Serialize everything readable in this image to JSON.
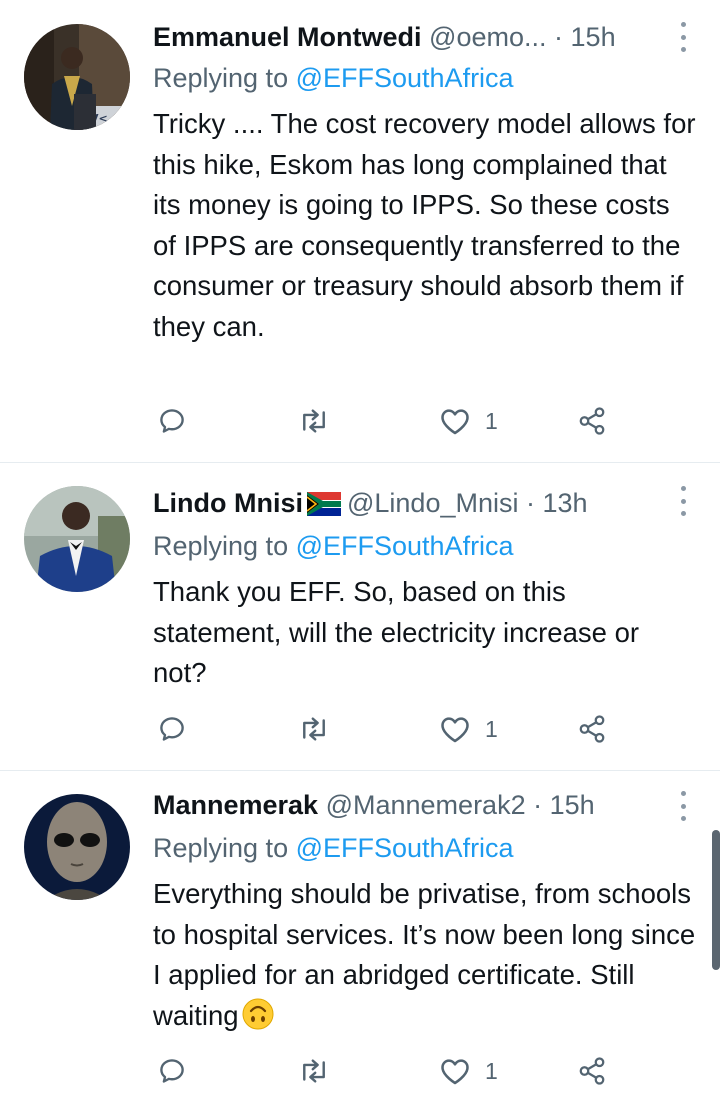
{
  "tweets": [
    {
      "name": "Emmanuel Montwedi",
      "handle": "@oemo...",
      "separator": "·",
      "time": "15h",
      "replying_prefix": "Replying to ",
      "replying_to": "@EFFSouthAfrica",
      "text": "Tricky .... The cost recovery model allows for this hike, Eskom has long complained that its money is going to IPPS. So these costs of IPPS are consequently transferred to the consumer or treasury should absorb them if they can.",
      "reply_count": "",
      "retweet_count": "",
      "like_count": "1"
    },
    {
      "name": "Lindo Mnisi",
      "flag": "south-africa-flag",
      "handle": "@Lindo_Mnisi",
      "separator": "·",
      "time": "13h",
      "replying_prefix": "Replying to ",
      "replying_to": "@EFFSouthAfrica",
      "text": "Thank you EFF. So, based on this statement, will the electricity increase or not?",
      "reply_count": "",
      "retweet_count": "",
      "like_count": "1"
    },
    {
      "name": "Mannemerak",
      "handle": "@Mannemerak2",
      "separator": "·",
      "time": "15h",
      "replying_prefix": "Replying to ",
      "replying_to": "@EFFSouthAfrica",
      "text": "Everything should be privatise, from schools to hospital services. It’s now been long since I applied for an abridged certificate. Still waiting",
      "emoji": "upside-down-face",
      "reply_count": "",
      "retweet_count": "",
      "like_count": "1"
    }
  ],
  "colors": {
    "accent": "#1d9bf0",
    "secondary_text": "#536471",
    "primary_text": "#0f1419",
    "divider": "#e6ecf0"
  },
  "icons": [
    "reply-icon",
    "retweet-icon",
    "like-icon",
    "share-icon",
    "more-icon"
  ]
}
